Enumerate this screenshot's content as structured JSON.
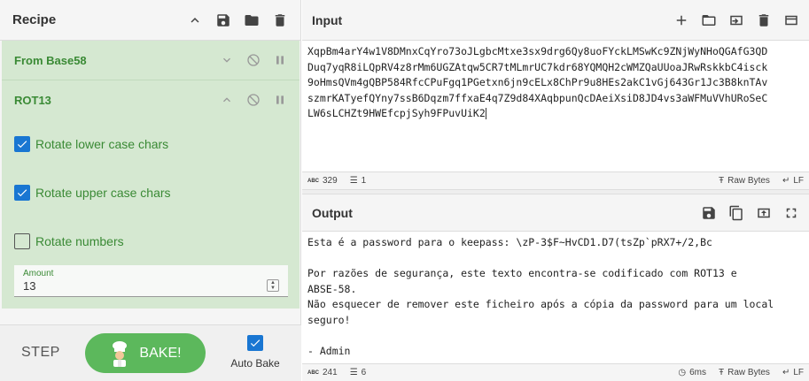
{
  "recipe": {
    "title": "Recipe",
    "operations": [
      {
        "name": "From Base58"
      },
      {
        "name": "ROT13",
        "options": [
          {
            "label": "Rotate lower case chars",
            "checked": true
          },
          {
            "label": "Rotate upper case chars",
            "checked": true
          },
          {
            "label": "Rotate numbers",
            "checked": false
          }
        ],
        "amount_label": "Amount",
        "amount_value": "13"
      }
    ]
  },
  "controls": {
    "step_label": "STEP",
    "bake_label": "BAKE!",
    "autobake_label": "Auto Bake",
    "autobake_checked": true
  },
  "input": {
    "title": "Input",
    "lines": [
      "XqpBm4arY4w1V8DMnxCqYro73oJLgbcMtxe3sx9drg6Qy8uoFYckLMSwKc9ZNjWyNHoQGAfG3QD",
      "Duq7yqR8iLQpRV4z8rMm6UGZAtqw5CR7tMLmrUC7kdr68YQMQH2cWMZQaUUoaJRwRskkbC4isck",
      "9oHmsQVm4gQBP584RfcCPuFgq1PGetxn6jn9cELx8ChPr9u8HEs2akC1vGj643Gr1Jc3B8knTAv",
      "szmrKATyefQYny7ssB6Dqzm7ffxaE4q7Z9d84XAqbpunQcDAeiXsiD8JD4vs3aWFMuVVhURoSeC",
      "LW6sLCHZt9HWEfcpjSyh9FPuvUiK2"
    ],
    "status": {
      "chars": "329",
      "lines": "1",
      "format": "Raw Bytes",
      "eol": "LF"
    }
  },
  "output": {
    "title": "Output",
    "lines": [
      "Esta é a password para o keepass: \\zP-3$F~HvCD1.D7(tsZp`pRX7+/2,Bc",
      "",
      "Por razões de segurança, este texto encontra-se codificado com ROT13 e",
      "ABSE-58.",
      "Não esquecer de remover este ficheiro após a cópia da password para um local",
      "seguro!",
      "",
      "- Admin"
    ],
    "status": {
      "chars": "241",
      "lines": "6",
      "time": "6ms",
      "format": "Raw Bytes",
      "eol": "LF"
    }
  }
}
